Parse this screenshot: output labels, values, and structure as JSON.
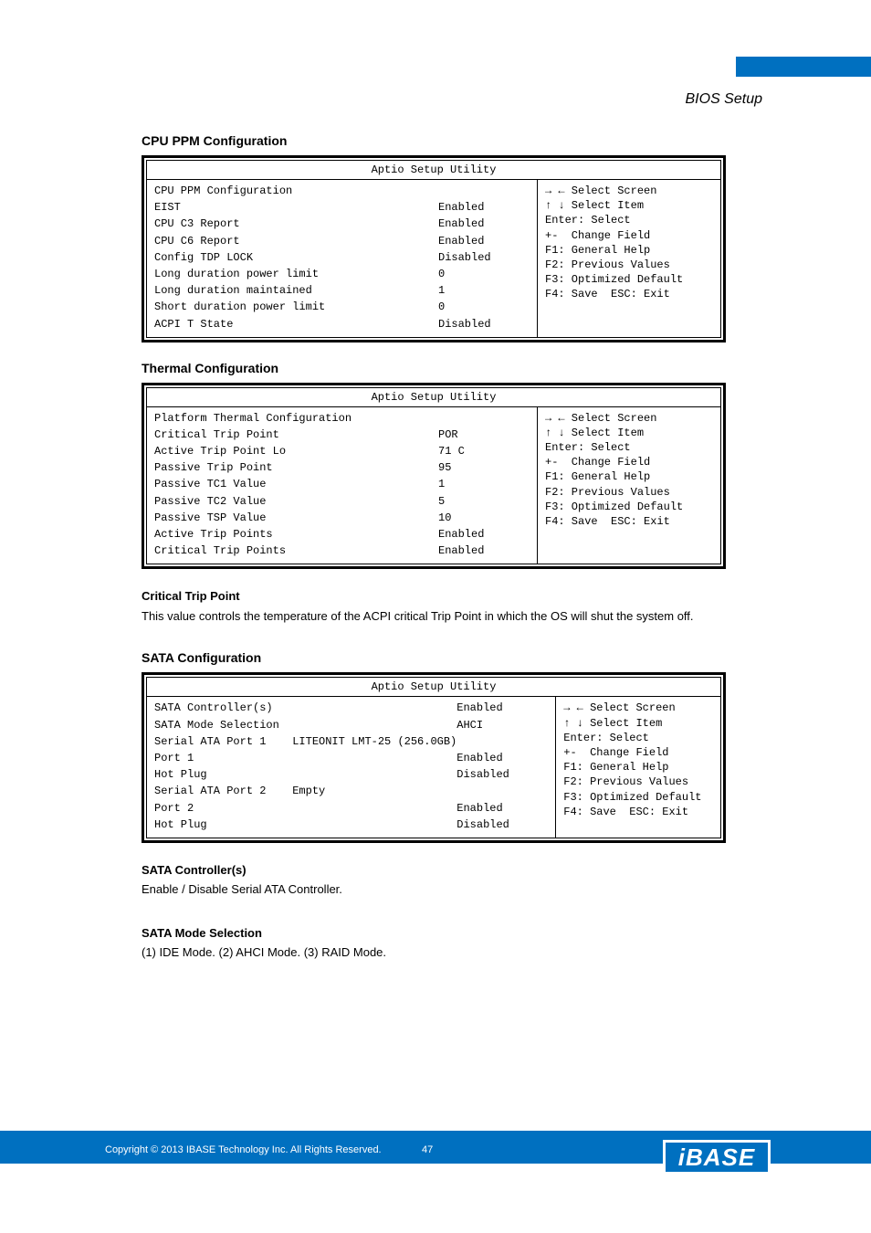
{
  "chapter_heading": "BIOS Setup",
  "bios_help_lines": [
    "→ ← Select Screen",
    "↑ ↓ Select Item",
    "Enter: Select",
    "+-  Change Field",
    "F1: General Help",
    "F2: Previous Values",
    "F3: Optimized Default",
    "F4: Save  ESC: Exit"
  ],
  "sections": [
    {
      "title": "CPU PPM Configuration",
      "bios_title": "Aptio Setup Utility",
      "rows": [
        {
          "label": "CPU PPM Configuration",
          "value": ""
        },
        {
          "label": "EIST",
          "value": "Enabled"
        },
        {
          "label": "CPU C3 Report",
          "value": "Enabled"
        },
        {
          "label": "CPU C6 Report",
          "value": "Enabled"
        },
        {
          "label": "Config TDP LOCK",
          "value": "Disabled"
        },
        {
          "label": "Long duration power limit",
          "value": "0"
        },
        {
          "label": "Long duration maintained",
          "value": "1"
        },
        {
          "label": "Short duration power limit",
          "value": "0"
        },
        {
          "label": "ACPI T State",
          "value": "Disabled"
        }
      ],
      "desc_heading": "",
      "desc_text": ""
    },
    {
      "title": "Thermal Configuration",
      "bios_title": "Aptio Setup Utility",
      "rows": [
        {
          "label": "Platform Thermal Configuration",
          "value": ""
        },
        {
          "label": "Critical Trip Point",
          "value": "POR"
        },
        {
          "label": "Active Trip Point Lo",
          "value": "71 C"
        },
        {
          "label": "Passive Trip Point",
          "value": "95"
        },
        {
          "label": "Passive TC1 Value",
          "value": "1"
        },
        {
          "label": "Passive TC2 Value",
          "value": "5"
        },
        {
          "label": "Passive TSP Value",
          "value": "10"
        },
        {
          "label": "Active Trip Points",
          "value": "Enabled"
        },
        {
          "label": "Critical Trip Points",
          "value": "Enabled"
        }
      ],
      "desc_heading": "Critical Trip Point",
      "desc_text": "This value controls the temperature of the ACPI critical Trip Point in which the OS will shut the system off."
    },
    {
      "title": "SATA Configuration",
      "bios_title": "Aptio Setup Utility",
      "rows": [
        {
          "label": "SATA Controller(s)",
          "value": "Enabled"
        },
        {
          "label": "SATA Mode Selection",
          "value": "AHCI"
        },
        {
          "label": "Serial ATA Port 1    LITEONIT LMT-25 (256.0GB)",
          "value": ""
        },
        {
          "label": "Port 1",
          "value": "Enabled"
        },
        {
          "label": "Hot Plug",
          "value": "Disabled"
        },
        {
          "label": "Serial ATA Port 2    Empty",
          "value": ""
        },
        {
          "label": "Port 2",
          "value": "Enabled"
        },
        {
          "label": "Hot Plug",
          "value": "Disabled"
        }
      ],
      "desc_heading": "SATA Controller(s)",
      "desc_text": "Enable / Disable Serial ATA Controller."
    }
  ],
  "sata_mode": {
    "heading": "SATA Mode Selection",
    "text": "(1) IDE Mode. (2) AHCI Mode. (3) RAID Mode."
  },
  "footer": {
    "copyright": "Copyright © 2013 IBASE Technology Inc. All Rights Reserved.",
    "page": "47",
    "logo": "iBASE"
  }
}
